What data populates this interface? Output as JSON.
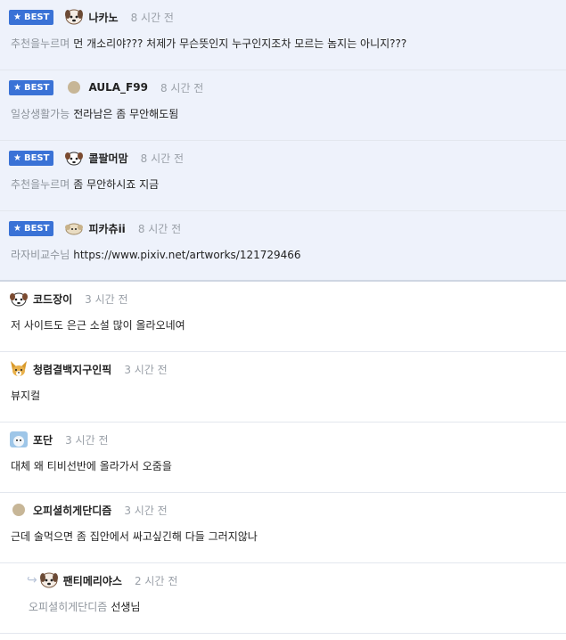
{
  "best_label": "BEST",
  "best_comments": [
    {
      "nick": "나카노",
      "time": "8 시간 전",
      "mention": "추천을누르며",
      "text": "먼 개소리야??? 처제가 무슨뜻인지 누구인지조차 모르는 놈지는 아니지???",
      "avatar": "dog-avatar-icon"
    },
    {
      "nick": "AULA_F99",
      "time": "8 시간 전",
      "mention": "일상생활가능",
      "text": "전라남은 좀 무안해도됨",
      "avatar": "circle-avatar-icon"
    },
    {
      "nick": "콜팔머맘",
      "time": "8 시간 전",
      "mention": "추천을누르며",
      "text": "좀 무안하시죠 지금",
      "avatar": "dog-avatar-icon"
    },
    {
      "nick": "피카츄ii",
      "time": "8 시간 전",
      "mention": "라자비교수님",
      "text": "https://www.pixiv.net/artworks/121729466",
      "avatar": "dog-avatar-icon"
    }
  ],
  "comments": [
    {
      "nick": "코드장이",
      "time": "3 시간 전",
      "text": "저 사이트도 은근 소설 많이 올라오네여",
      "avatar": "dog-avatar-icon"
    },
    {
      "nick": "청렴결백지구인픽",
      "time": "3 시간 전",
      "text": "뷰지컬",
      "avatar": "fox-avatar-icon"
    },
    {
      "nick": "포단",
      "time": "3 시간 전",
      "text": "대체 왜 티비선반에 올라가서 오줌을",
      "avatar": "cat-avatar-icon"
    },
    {
      "nick": "오피셜히게단디즘",
      "time": "3 시간 전",
      "text": "근데 술먹으면 좀 집안에서 싸고싶긴해 다들 그러지않나",
      "avatar": "circle-avatar-icon"
    }
  ],
  "reply": {
    "nick": "팬티메리야스",
    "time": "2 시간 전",
    "mention": "오피셜히게단디즘",
    "text": "선생님",
    "avatar": "dog-avatar-icon"
  }
}
